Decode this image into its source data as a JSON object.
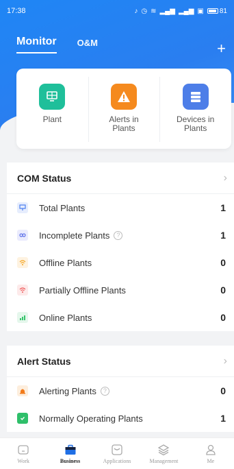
{
  "status_bar": {
    "time": "17:38",
    "battery": "81"
  },
  "header": {
    "tabs": [
      {
        "label": "Monitor"
      },
      {
        "label": "O&M"
      }
    ]
  },
  "quick_cards": [
    {
      "label": "Plant",
      "icon": "plant-monitor-icon"
    },
    {
      "label": "Alerts in Plants",
      "icon": "alert-triangle-icon"
    },
    {
      "label": "Devices in Plants",
      "icon": "devices-stack-icon"
    }
  ],
  "com_status": {
    "title": "COM Status",
    "rows": [
      {
        "label": "Total Plants",
        "value": "1",
        "icon": "plant-icon",
        "color": "#4a7ef0"
      },
      {
        "label": "Incomplete Plants",
        "value": "1",
        "icon": "incomplete-icon",
        "color": "#5b6fe8"
      },
      {
        "label": "Offline Plants",
        "value": "0",
        "icon": "wifi-offline-icon",
        "color": "#f5a623"
      },
      {
        "label": "Partially Offline Plants",
        "value": "0",
        "icon": "wifi-partial-icon",
        "color": "#ef5b5b"
      },
      {
        "label": "Online Plants",
        "value": "0",
        "icon": "signal-online-icon",
        "color": "#35c46b"
      }
    ]
  },
  "alert_status": {
    "title": "Alert Status",
    "rows": [
      {
        "label": "Alerting Plants",
        "value": "0",
        "icon": "alarm-icon",
        "color": "#f27b1b"
      },
      {
        "label": "Normally Operating Plants",
        "value": "1",
        "icon": "shield-check-icon",
        "color": "#2fbf6a"
      }
    ]
  },
  "bottom_nav": [
    {
      "label": "Work"
    },
    {
      "label": "Business"
    },
    {
      "label": "Applications"
    },
    {
      "label": "Management"
    },
    {
      "label": "Me"
    }
  ]
}
